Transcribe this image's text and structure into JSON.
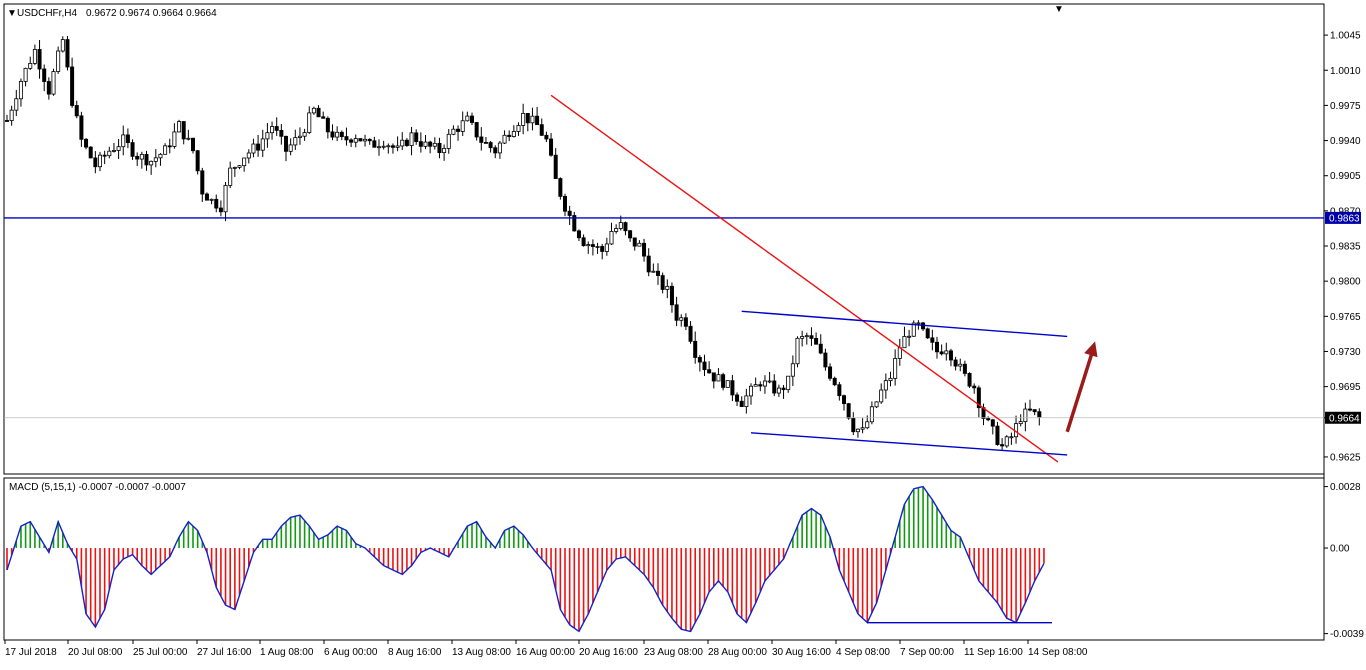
{
  "header": {
    "symbol": "USDCHFr,H4",
    "ohlc": "0.9672 0.9674 0.9664 0.9664"
  },
  "macd_header": {
    "label": "MACD (5,15,1) -0.0007 -0.0007 -0.0007"
  },
  "colors": {
    "bull_candle": "#000000",
    "bear_candle": "#000000",
    "support_line": "#0000cc",
    "trend_line": "#ee1111",
    "macd_positive": "#119911",
    "macd_negative": "#ee1111",
    "macd_signal": "#1122cc",
    "arrow": "#9b1b1b",
    "price_tag_bg": "#0000aa"
  },
  "chart_data": [
    {
      "type": "candlestick",
      "title": "USDCHFr,H4",
      "ylim": [
        0.961,
        1.007
      ],
      "y_ticks": [
        "1.0045",
        "1.0010",
        "0.9975",
        "0.9940",
        "0.9905",
        "0.9870",
        "0.9835",
        "0.9800",
        "0.9765",
        "0.9730",
        "0.9695",
        "0.9664",
        "0.9625"
      ],
      "x_ticks": [
        "17 Jul 2018",
        "20 Jul 08:00",
        "25 Jul 00:00",
        "27 Jul 16:00",
        "1 Aug 08:00",
        "6 Aug 00:00",
        "8 Aug 16:00",
        "13 Aug 08:00",
        "16 Aug 00:00",
        "20 Aug 16:00",
        "23 Aug 08:00",
        "28 Aug 00:00",
        "30 Aug 16:00",
        "4 Sep 08:00",
        "7 Sep 00:00",
        "11 Sep 16:00",
        "14 Sep 08:00"
      ],
      "horizontal_line": {
        "value": 0.9863,
        "label": "0.9863"
      },
      "current_price": {
        "value": 0.9664,
        "label": "0.9664"
      },
      "close_path": [
        [
          0,
          0.996
        ],
        [
          3,
          1.0
        ],
        [
          6,
          1.003
        ],
        [
          9,
          0.999
        ],
        [
          12,
          1.004
        ],
        [
          14,
          0.998
        ],
        [
          16,
          0.994
        ],
        [
          19,
          0.9915
        ],
        [
          22,
          0.993
        ],
        [
          25,
          0.994
        ],
        [
          28,
          0.9925
        ],
        [
          31,
          0.992
        ],
        [
          34,
          0.993
        ],
        [
          37,
          0.9955
        ],
        [
          40,
          0.993
        ],
        [
          42,
          0.989
        ],
        [
          44,
          0.988
        ],
        [
          46,
          0.9875
        ],
        [
          48,
          0.991
        ],
        [
          51,
          0.9925
        ],
        [
          54,
          0.9935
        ],
        [
          57,
          0.9955
        ],
        [
          60,
          0.993
        ],
        [
          63,
          0.9945
        ],
        [
          66,
          0.997
        ],
        [
          69,
          0.995
        ],
        [
          72,
          0.994
        ],
        [
          75,
          0.9945
        ],
        [
          78,
          0.9935
        ],
        [
          81,
          0.994
        ],
        [
          84,
          0.993
        ],
        [
          87,
          0.9945
        ],
        [
          90,
          0.9935
        ],
        [
          93,
          0.993
        ],
        [
          96,
          0.995
        ],
        [
          99,
          0.996
        ],
        [
          102,
          0.994
        ],
        [
          105,
          0.993
        ],
        [
          108,
          0.995
        ],
        [
          111,
          0.9965
        ],
        [
          114,
          0.9955
        ],
        [
          116,
          0.994
        ],
        [
          118,
          0.99
        ],
        [
          120,
          0.9875
        ],
        [
          122,
          0.9855
        ],
        [
          124,
          0.984
        ],
        [
          126,
          0.9835
        ],
        [
          128,
          0.983
        ],
        [
          130,
          0.985
        ],
        [
          132,
          0.9855
        ],
        [
          134,
          0.984
        ],
        [
          136,
          0.9835
        ],
        [
          138,
          0.9815
        ],
        [
          140,
          0.98
        ],
        [
          142,
          0.979
        ],
        [
          144,
          0.9765
        ],
        [
          146,
          0.976
        ],
        [
          148,
          0.973
        ],
        [
          150,
          0.9715
        ],
        [
          152,
          0.9705
        ],
        [
          154,
          0.97
        ],
        [
          156,
          0.969
        ],
        [
          158,
          0.968
        ],
        [
          160,
          0.969
        ],
        [
          162,
          0.97
        ],
        [
          164,
          0.9695
        ],
        [
          166,
          0.969
        ],
        [
          168,
          0.97
        ],
        [
          170,
          0.974
        ],
        [
          172,
          0.9745
        ],
        [
          174,
          0.9735
        ],
        [
          176,
          0.9715
        ],
        [
          178,
          0.97
        ],
        [
          180,
          0.968
        ],
        [
          182,
          0.9655
        ],
        [
          184,
          0.965
        ],
        [
          186,
          0.967
        ],
        [
          188,
          0.969
        ],
        [
          190,
          0.9705
        ],
        [
          192,
          0.9735
        ],
        [
          194,
          0.975
        ],
        [
          196,
          0.9755
        ],
        [
          198,
          0.974
        ],
        [
          200,
          0.973
        ],
        [
          202,
          0.9735
        ],
        [
          204,
          0.972
        ],
        [
          206,
          0.9705
        ],
        [
          208,
          0.9695
        ],
        [
          210,
          0.9665
        ],
        [
          212,
          0.965
        ],
        [
          214,
          0.9635
        ],
        [
          216,
          0.9645
        ],
        [
          218,
          0.9665
        ],
        [
          220,
          0.967
        ],
        [
          222,
          0.9664
        ]
      ],
      "trend_line": [
        [
          117,
          0.9985
        ],
        [
          226,
          0.962
        ]
      ],
      "channel_upper": [
        [
          158,
          0.977
        ],
        [
          228,
          0.9745
        ]
      ],
      "channel_lower": [
        [
          160,
          0.9649
        ],
        [
          228,
          0.9627
        ]
      ],
      "arrow": [
        [
          228,
          0.965
        ],
        [
          234,
          0.974
        ]
      ]
    },
    {
      "type": "bar",
      "title": "MACD (5,15,1)",
      "values_label": "-0.0007 -0.0007 -0.0007",
      "ylim": [
        -0.0041,
        0.0031
      ],
      "y_ticks": [
        "0.0028",
        "0.00",
        "-0.0039"
      ],
      "macd_path": [
        [
          0,
          -0.001
        ],
        [
          3,
          0.001
        ],
        [
          5,
          0.0012
        ],
        [
          7,
          0.0005
        ],
        [
          9,
          -0.0002
        ],
        [
          11,
          0.0012
        ],
        [
          13,
          0.0002
        ],
        [
          15,
          -0.0005
        ],
        [
          17,
          -0.003
        ],
        [
          19,
          -0.0036
        ],
        [
          21,
          -0.0028
        ],
        [
          23,
          -0.001
        ],
        [
          25,
          -0.0005
        ],
        [
          27,
          -0.0003
        ],
        [
          29,
          -0.0008
        ],
        [
          31,
          -0.0012
        ],
        [
          33,
          -0.0008
        ],
        [
          35,
          -0.0004
        ],
        [
          37,
          0.0005
        ],
        [
          39,
          0.0012
        ],
        [
          41,
          0.0008
        ],
        [
          43,
          -0.0002
        ],
        [
          45,
          -0.0018
        ],
        [
          47,
          -0.0026
        ],
        [
          49,
          -0.0028
        ],
        [
          51,
          -0.0015
        ],
        [
          53,
          -0.0002
        ],
        [
          55,
          0.0004
        ],
        [
          57,
          0.0004
        ],
        [
          59,
          0.001
        ],
        [
          61,
          0.0014
        ],
        [
          63,
          0.0015
        ],
        [
          65,
          0.001
        ],
        [
          67,
          0.0004
        ],
        [
          69,
          0.0006
        ],
        [
          71,
          0.001
        ],
        [
          73,
          0.0008
        ],
        [
          75,
          0.0002
        ],
        [
          77,
          0.0
        ],
        [
          79,
          -0.0004
        ],
        [
          81,
          -0.0008
        ],
        [
          83,
          -0.001
        ],
        [
          85,
          -0.0012
        ],
        [
          87,
          -0.0008
        ],
        [
          89,
          -0.0002
        ],
        [
          91,
          0.0
        ],
        [
          93,
          -0.0002
        ],
        [
          95,
          -0.0004
        ],
        [
          97,
          0.0003
        ],
        [
          99,
          0.001
        ],
        [
          101,
          0.0012
        ],
        [
          103,
          0.0005
        ],
        [
          105,
          0.0
        ],
        [
          107,
          0.0008
        ],
        [
          109,
          0.001
        ],
        [
          111,
          0.0006
        ],
        [
          113,
          0.0
        ],
        [
          115,
          -0.0005
        ],
        [
          117,
          -0.001
        ],
        [
          119,
          -0.0028
        ],
        [
          121,
          -0.0035
        ],
        [
          123,
          -0.0038
        ],
        [
          125,
          -0.003
        ],
        [
          127,
          -0.002
        ],
        [
          129,
          -0.001
        ],
        [
          131,
          -0.0005
        ],
        [
          133,
          -0.0004
        ],
        [
          135,
          -0.0008
        ],
        [
          137,
          -0.0012
        ],
        [
          139,
          -0.0018
        ],
        [
          141,
          -0.0026
        ],
        [
          143,
          -0.0032
        ],
        [
          145,
          -0.0037
        ],
        [
          147,
          -0.0038
        ],
        [
          149,
          -0.003
        ],
        [
          151,
          -0.002
        ],
        [
          153,
          -0.0015
        ],
        [
          155,
          -0.002
        ],
        [
          157,
          -0.003
        ],
        [
          159,
          -0.0034
        ],
        [
          161,
          -0.0025
        ],
        [
          163,
          -0.0015
        ],
        [
          165,
          -0.001
        ],
        [
          167,
          -0.0005
        ],
        [
          169,
          0.0005
        ],
        [
          171,
          0.0015
        ],
        [
          173,
          0.0018
        ],
        [
          175,
          0.0015
        ],
        [
          177,
          0.0005
        ],
        [
          179,
          -0.001
        ],
        [
          181,
          -0.002
        ],
        [
          183,
          -0.003
        ],
        [
          185,
          -0.0034
        ],
        [
          187,
          -0.0025
        ],
        [
          189,
          -0.001
        ],
        [
          191,
          0.0005
        ],
        [
          193,
          0.002
        ],
        [
          195,
          0.0027
        ],
        [
          197,
          0.0028
        ],
        [
          199,
          0.0022
        ],
        [
          201,
          0.0015
        ],
        [
          203,
          0.0008
        ],
        [
          205,
          0.0005
        ],
        [
          207,
          -0.0005
        ],
        [
          209,
          -0.0015
        ],
        [
          211,
          -0.002
        ],
        [
          213,
          -0.0025
        ],
        [
          215,
          -0.0032
        ],
        [
          217,
          -0.0034
        ],
        [
          219,
          -0.0025
        ],
        [
          221,
          -0.0015
        ],
        [
          223,
          -0.0007
        ]
      ],
      "support_lines": [
        [
          [
            185,
            -0.0034
          ],
          [
            223,
            -0.0034
          ]
        ]
      ]
    }
  ]
}
